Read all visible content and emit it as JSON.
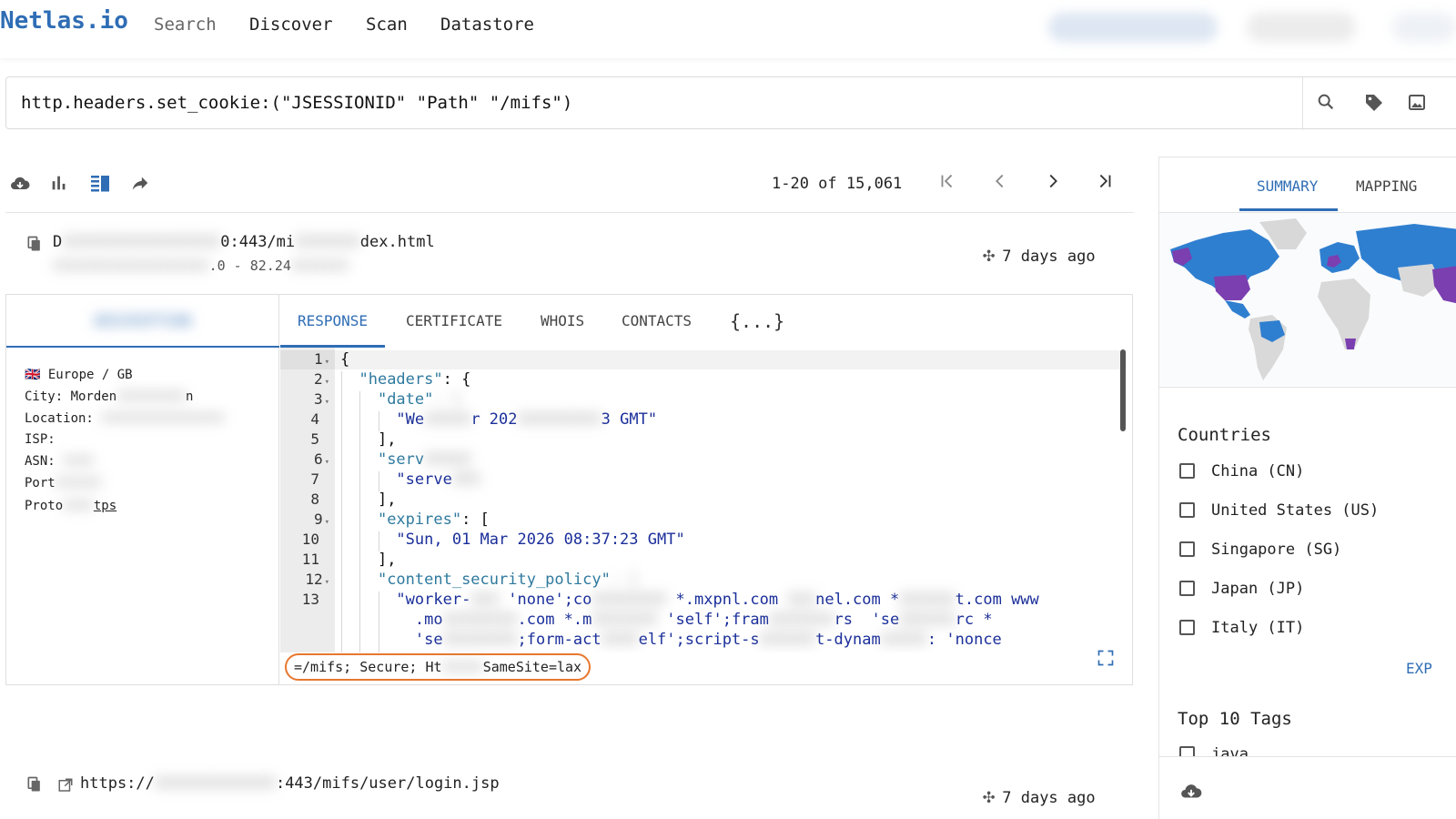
{
  "nav": {
    "logo": "Netlas.io",
    "items": [
      "Search",
      "Discover",
      "Scan",
      "Datastore"
    ]
  },
  "search": {
    "query": "http.headers.set_cookie:(\"JSESSIONID\" \"Path\" \"/mifs\")"
  },
  "icons": {
    "search": "search-icon",
    "tag": "tag-icon",
    "image_search": "image-search-icon",
    "download": "cloud-download-icon",
    "stats": "bar-chart-icon",
    "view": "list-view-icon",
    "share": "share-icon"
  },
  "pager": {
    "range": "1-20 of 15,061",
    "first": "|<",
    "prev": "<",
    "next": ">",
    "last": ">|"
  },
  "result1": {
    "url_prefix": "D",
    "url_mid": "0:443/mi",
    "url_suffix": "dex.html",
    "sub_a": ".0 - 82.24",
    "time": "7 days ago",
    "description_tab": "DESCRIPTION",
    "info": {
      "region": "Europe / GB",
      "city_label": "City: Morden",
      "city_rest": "n",
      "location_label": "Location:",
      "isp_label": "ISP:",
      "asn_label": "ASN:",
      "port_label": "Port",
      "protocol_label": "Proto",
      "protocol_value": "tps"
    },
    "tabs": [
      "RESPONSE",
      "CERTIFICATE",
      "WHOIS",
      "CONTACTS",
      "{...}"
    ],
    "code_lines": [
      {
        "n": "1",
        "fold": true
      },
      {
        "n": "2",
        "fold": true
      },
      {
        "n": "3",
        "fold": true
      },
      {
        "n": "4",
        "fold": false
      },
      {
        "n": "5",
        "fold": false
      },
      {
        "n": "6",
        "fold": true
      },
      {
        "n": "7",
        "fold": false
      },
      {
        "n": "8",
        "fold": false
      },
      {
        "n": "9",
        "fold": true
      },
      {
        "n": "10",
        "fold": false
      },
      {
        "n": "11",
        "fold": false
      },
      {
        "n": "12",
        "fold": true
      },
      {
        "n": "13",
        "fold": false
      }
    ],
    "code": {
      "l1": "{",
      "l2_key": "\"headers\"",
      "l2_rest": ": {",
      "l3_key": "\"date\"",
      "l4_a": "\"We",
      "l4_b": "r 202",
      "l4_c": "3 GMT\"",
      "l5": "],",
      "l6_key": "\"serv",
      "l7_val": "\"serve",
      "l8": "],",
      "l9_key": "\"expires\"",
      "l9_rest": ": [",
      "l10_val": "\"Sun, 01 Mar 2026 08:37:23 GMT\"",
      "l11": "],",
      "l12_key": "\"content_security_policy\"",
      "l13_a": "\"worker-",
      "l13_b": "'none';co",
      "l13_c": "*.mxpnl.com",
      "l13_d": "nel.com *",
      "l13_e": "t.com www",
      "l14_a": ".mo",
      "l14_b": ".com *.m",
      "l14_c": "'self';fram",
      "l14_d": "rs  'se",
      "l14_e": "rc *",
      "l15_a": "'se",
      "l15_b": ";form-act",
      "l15_c": "elf';script-s",
      "l15_d": "t-dynam",
      "l15_e": ": 'nonce"
    },
    "footer_snippet_a": "=/mifs; Secure; Ht",
    "footer_snippet_b": "SameSite=lax"
  },
  "result2": {
    "url_a": "https://",
    "url_b": ":443/mifs/user/login.jsp",
    "time": "7 days ago"
  },
  "panel": {
    "tabs": [
      "SUMMARY",
      "MAPPING"
    ],
    "countries_title": "Countries",
    "countries": [
      "China (CN)",
      "United States (US)",
      "Singapore (SG)",
      "Japan (JP)",
      "Italy (IT)"
    ],
    "expand_label": "EXP",
    "tags_title": "Top 10 Tags",
    "first_tag": "java"
  },
  "colors": {
    "accent": "#2f6db5",
    "map_blue": "#2f7fd0",
    "map_purple": "#7b3fb0",
    "highlight": "#e8772e"
  }
}
